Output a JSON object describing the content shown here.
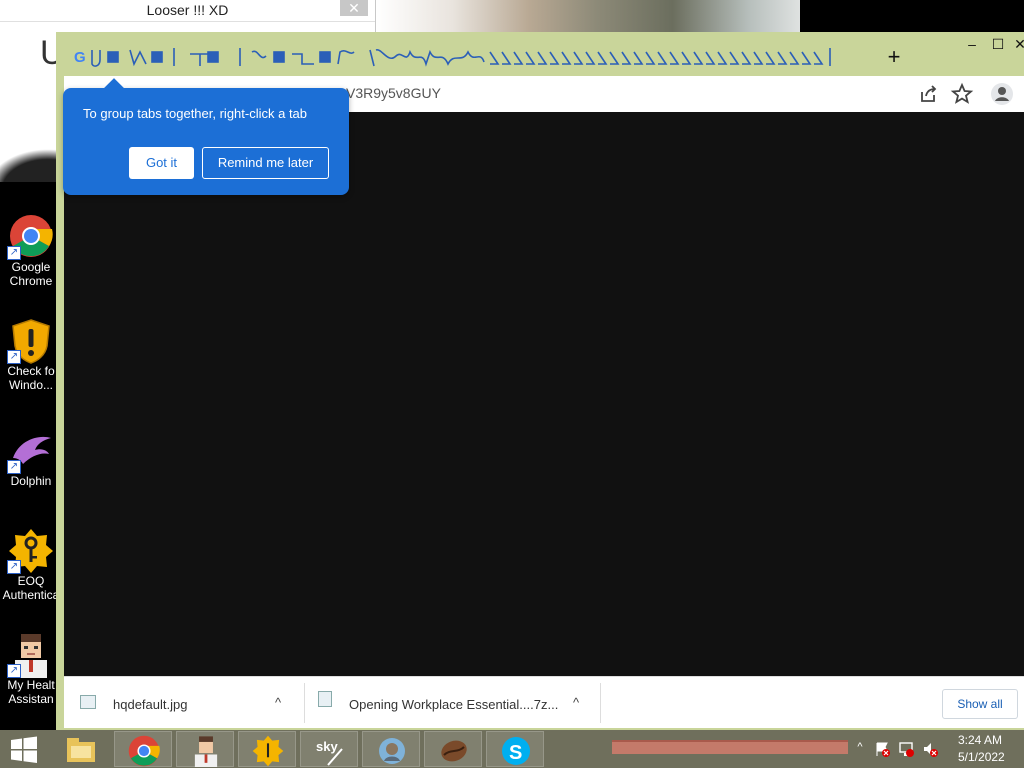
{
  "background_window": {
    "title": "Looser !!! XD",
    "close_glyph": "✕",
    "partial_text": "U"
  },
  "desktop_icons": [
    {
      "label_line1": "Google",
      "label_line2": "Chrome",
      "icon": "chrome-icon"
    },
    {
      "label_line1": "Check fo",
      "label_line2": "Windo...",
      "icon": "shield-warning-icon"
    },
    {
      "label_line1": "Dolphin",
      "label_line2": "",
      "icon": "dolphin-icon"
    },
    {
      "label_line1": "EOQ",
      "label_line2": "Authentica",
      "icon": "key-icon"
    },
    {
      "label_line1": "My Healt",
      "label_line2": "Assistan",
      "icon": "doctor-icon"
    }
  ],
  "chrome": {
    "favicon_letter": "G",
    "new_tab_glyph": "+",
    "minimize_glyph": "–",
    "maximize_glyph": "☐",
    "close_glyph": "✕",
    "omnibox_text": "V3R9y5v8GUY",
    "colors": {
      "frame": "#c9d59a",
      "accent": "#1c6fd6",
      "content": "#111111"
    }
  },
  "promo": {
    "message": "To group tabs together, right-click a tab",
    "got_it_label": "Got it",
    "remind_label": "Remind me later"
  },
  "downloads": {
    "items": [
      {
        "name": "hqdefault.jpg",
        "icon": "image-file-icon"
      },
      {
        "name": "Opening Workplace Essential....7z...",
        "icon": "archive-file-icon"
      }
    ],
    "chevron_glyph": "^",
    "show_all_label": "Show all"
  },
  "taskbar": {
    "apps": [
      "file-explorer-icon",
      "chrome-icon",
      "doctor-icon",
      "key-icon",
      "sky-icon",
      "media-player-icon",
      "coffee-bean-icon",
      "skype-icon"
    ],
    "tray_up_glyph": "^",
    "time": "3:24 AM",
    "date": "5/1/2022"
  }
}
